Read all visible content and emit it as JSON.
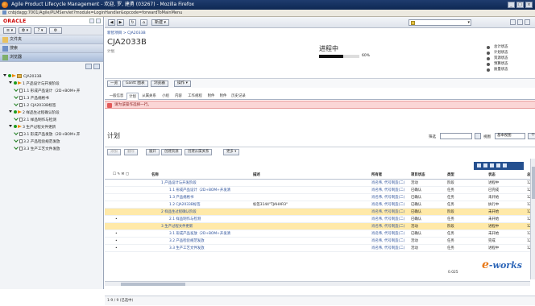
{
  "window": {
    "title": "Agile Product Lifecycle Management - 欢迎, 罗, 建勇 (03267) - Mozilla Firefox",
    "address": "cnbjdagg:7001/Agile/PLMServlet?module=LoginHandler&opcode=forwardToMainMenu"
  },
  "left": {
    "brand": "ORACLE",
    "toolbar": [
      "≡ ▾",
      "✿ ▾",
      "? ▾",
      "⚙"
    ],
    "nav": [
      {
        "label": "文件夹",
        "active": false
      },
      {
        "label": "搜索",
        "active": false
      },
      {
        "label": "浏览器",
        "active": true
      }
    ],
    "tree": [
      {
        "indent": 0,
        "type": "root",
        "label": "CJA2033B"
      },
      {
        "indent": 1,
        "type": "group",
        "label": "1 产品设计与开发阶段"
      },
      {
        "indent": 2,
        "type": "task",
        "label": "1.1 形成产品设计（2D+BOM+开"
      },
      {
        "indent": 2,
        "type": "task",
        "label": "1.3 产品规格书"
      },
      {
        "indent": 2,
        "type": "task",
        "label": "1.2 CJA2033B标签"
      },
      {
        "indent": 1,
        "type": "group",
        "label": "2 样品生过程确认阶段"
      },
      {
        "indent": 2,
        "type": "task",
        "label": "2.1 样品制作与检测"
      },
      {
        "indent": 1,
        "type": "group",
        "label": "3 生产过程文件更新"
      },
      {
        "indent": 2,
        "type": "task",
        "label": "3.1 形成产品发放（2D+BOM+开"
      },
      {
        "indent": 2,
        "type": "task",
        "label": "3.2 产品检验规范发放"
      },
      {
        "indent": 2,
        "type": "task",
        "label": "3.3 生产工艺文件发放"
      }
    ]
  },
  "main": {
    "nav_toolbar": {
      "back": "◀",
      "fwd": "▶",
      "refresh": "↻",
      "home": "⌂",
      "new_label": "新建 ▾",
      "search_placeholder": ""
    },
    "breadcrumb": "新智项目 > CJA2033B",
    "object_title": "CJA2033B",
    "object_sub": "计划",
    "status": "进程中",
    "progress_percent": 60,
    "progress_label": "60%",
    "status_list": [
      {
        "label": "总计状态",
        "color": "#555555"
      },
      {
        "label": "计划状态",
        "color": "#555555"
      },
      {
        "label": "资源状态",
        "color": "#555555"
      },
      {
        "label": "预算状态",
        "color": "#555555"
      },
      {
        "label": "质量状态",
        "color": "#555555"
      }
    ],
    "actions": [
      "一览",
      "Gantt 图表",
      "浏览器",
      "操作 ▾"
    ],
    "tabs": [
      "一般信息",
      "计划",
      "从属关系",
      "小组",
      "内容",
      "工作规程",
      "附件",
      "附件",
      "历史记录"
    ],
    "active_tab": 1,
    "warning": "请为该操作选择一行。",
    "plan_heading": "计划",
    "filter_label": "筛选",
    "view_label": "视图",
    "view_value": "基本视图",
    "customize": "个性化",
    "sub_actions": [
      {
        "label": "添加",
        "disabled": true
      },
      {
        "label": "删除",
        "disabled": true
      },
      {
        "label": "展开",
        "disabled": false
      },
      {
        "label": "创建资源",
        "disabled": false
      },
      {
        "label": "创建从属关系",
        "disabled": false
      },
      {
        "label": "更多 ▾",
        "disabled": false
      }
    ],
    "columns": {
      "name": "名称",
      "desc": "描述",
      "owner": "所有者",
      "pstatus": "项目状态",
      "type": "类型",
      "status": "状态",
      "num": "总"
    },
    "rows": [
      {
        "name": "1 产品设计与开发阶段",
        "desc": "",
        "owner": "肖名伟, 代号制造(二)",
        "pstatus": "活动",
        "type": "阶段",
        "status": "进程中",
        "num": "12.",
        "sel": false,
        "mark": ""
      },
      {
        "name": "1.1 形成产品设计（2D+BOM+开发清",
        "desc": "",
        "owner": "肖名伟, 代号制造(二)",
        "pstatus": "已确认",
        "type": "任务",
        "status": "已完成",
        "num": "12.",
        "sel": false,
        "mark": ""
      },
      {
        "name": "1.3 产品规格书",
        "desc": "",
        "owner": "肖名伟, 代号制造(二)",
        "pstatus": "已确认",
        "type": "任务",
        "status": "未开始",
        "num": "12.",
        "sel": false,
        "mark": ""
      },
      {
        "name": "1.2 CJA2033B标签",
        "desc": "标签3144\"TJAHAR3\"",
        "owner": "肖名伟, 代号制造(二)",
        "pstatus": "已确认",
        "type": "任务",
        "status": "执行中",
        "num": "12.",
        "sel": false,
        "mark": ""
      },
      {
        "name": "2 样品生过程确认阶段",
        "desc": "",
        "owner": "肖名伟, 代号制造(二)",
        "pstatus": "已确认",
        "type": "阶段",
        "status": "未开始",
        "num": "12.",
        "sel": true,
        "mark": ""
      },
      {
        "name": "2.1 样品制作与检测",
        "desc": "",
        "owner": "肖名伟, 代号制造(二)",
        "pstatus": "已确认",
        "type": "任务",
        "status": "未开始",
        "num": "12.",
        "sel": false,
        "mark": "•"
      },
      {
        "name": "3 生产过程文件更新",
        "desc": "",
        "owner": "肖名伟, 代号制造(二)",
        "pstatus": "活动",
        "type": "阶段",
        "status": "进程中",
        "num": "12.",
        "sel": true,
        "mark": ""
      },
      {
        "name": "3.1 形成产品发放（2D+BOM+开发清",
        "desc": "",
        "owner": "肖名伟, 代号制造(二)",
        "pstatus": "已确认",
        "type": "任务",
        "status": "未开始",
        "num": "12.",
        "sel": false,
        "mark": "•"
      },
      {
        "name": "3.2 产品检验规范发放",
        "desc": "",
        "owner": "肖名伟, 代号制造(二)",
        "pstatus": "活动",
        "type": "任务",
        "status": "完成",
        "num": "12.",
        "sel": false,
        "mark": "•"
      },
      {
        "name": "3.3 生产工艺文件发放",
        "desc": "",
        "owner": "肖名伟, 代号制造(二)",
        "pstatus": "活动",
        "type": "任务",
        "status": "进程中",
        "num": "12.",
        "sel": false,
        "mark": "•"
      }
    ],
    "bottom_status": "1-9 / 9 (已选中)",
    "download_badge": "0.025"
  },
  "watermark": {
    "e": "e",
    "rest": "-works"
  }
}
